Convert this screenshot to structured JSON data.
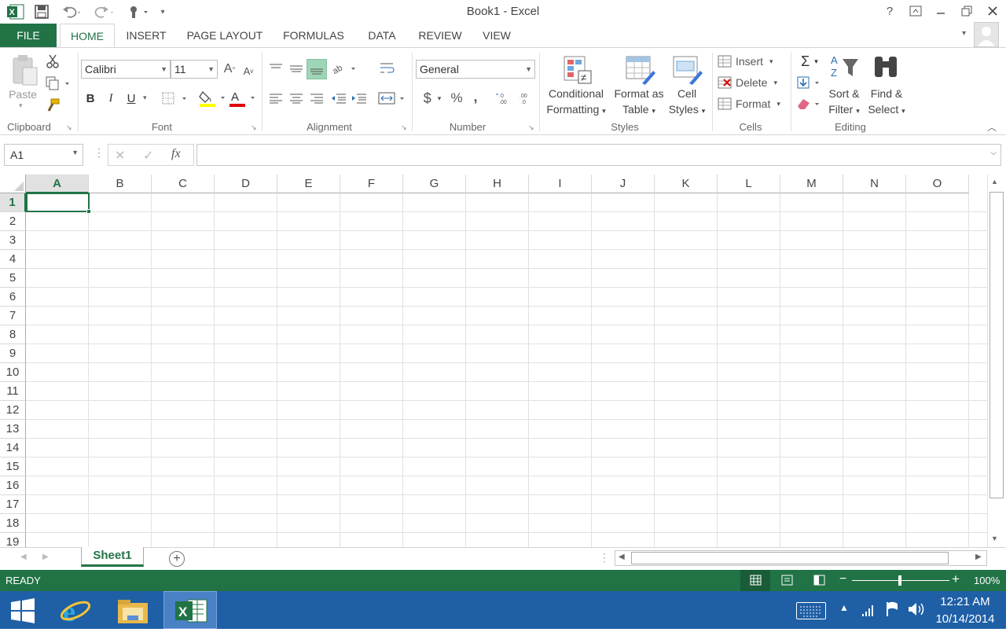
{
  "window": {
    "title": "Book1 - Excel"
  },
  "quick_access": {
    "icons": [
      "excel-logo-icon",
      "save-icon",
      "undo-icon",
      "redo-icon",
      "touch-mode-icon",
      "customize-icon"
    ]
  },
  "window_controls": {
    "help": "?",
    "minimize": "—",
    "restore": "❐",
    "close": "✕"
  },
  "tabs": [
    "FILE",
    "HOME",
    "INSERT",
    "PAGE LAYOUT",
    "FORMULAS",
    "DATA",
    "REVIEW",
    "VIEW"
  ],
  "active_tab": "HOME",
  "ribbon": {
    "clipboard": {
      "label": "Clipboard",
      "paste": "Paste"
    },
    "font": {
      "label": "Font",
      "font_name": "Calibri",
      "font_size": "11",
      "bold": "B",
      "italic": "I",
      "underline": "U",
      "grow": "A",
      "shrink": "A"
    },
    "alignment": {
      "label": "Alignment"
    },
    "number": {
      "label": "Number",
      "format": "General",
      "currency": "$",
      "percent": "%",
      "comma": ","
    },
    "styles": {
      "label": "Styles",
      "conditional": [
        "Conditional",
        "Formatting"
      ],
      "format_table": [
        "Format as",
        "Table"
      ],
      "cell_styles": [
        "Cell",
        "Styles"
      ]
    },
    "cells": {
      "label": "Cells",
      "insert": "Insert",
      "delete": "Delete",
      "format": "Format"
    },
    "editing": {
      "label": "Editing",
      "sort": [
        "Sort &",
        "Filter"
      ],
      "find": [
        "Find &",
        "Select"
      ]
    }
  },
  "formula_bar": {
    "name_box": "A1",
    "fx": "fx",
    "value": ""
  },
  "grid": {
    "columns": [
      "A",
      "B",
      "C",
      "D",
      "E",
      "F",
      "G",
      "H",
      "I",
      "J",
      "K",
      "L",
      "M",
      "N",
      "O"
    ],
    "rows": [
      "1",
      "2",
      "3",
      "4",
      "5",
      "6",
      "7",
      "8",
      "9",
      "10",
      "11",
      "12",
      "13",
      "14",
      "15",
      "16",
      "17",
      "18",
      "19"
    ],
    "selected_cell": "A1"
  },
  "sheets": {
    "tabs": [
      "Sheet1"
    ],
    "active": "Sheet1"
  },
  "status_bar": {
    "mode": "READY",
    "zoom": "100%"
  },
  "taskbar": {
    "time": "12:21 AM",
    "date": "10/14/2014"
  },
  "colors": {
    "accent": "#217346",
    "taskbar": "#1f5fa6"
  }
}
